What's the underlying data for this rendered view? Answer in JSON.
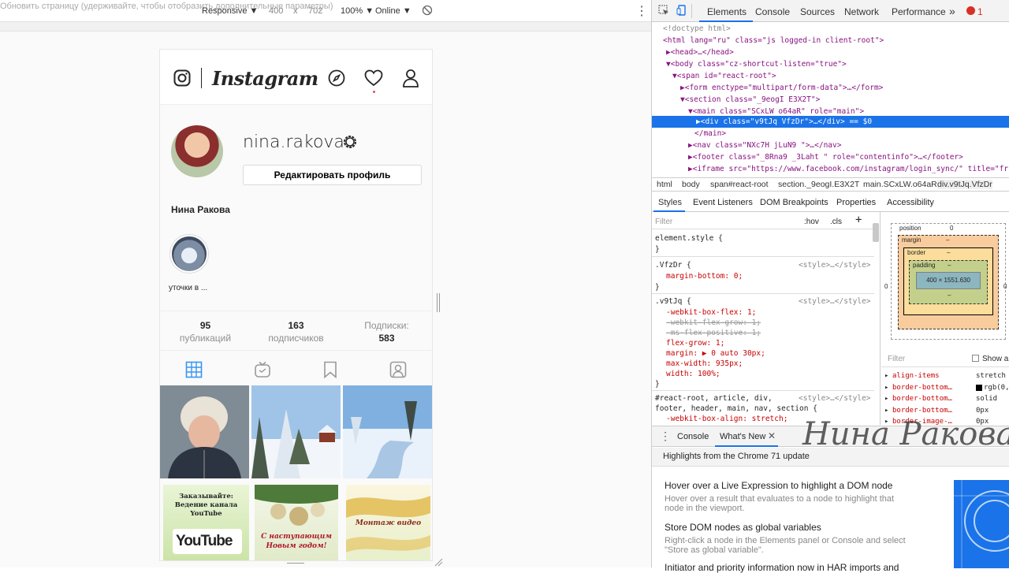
{
  "devbar": {
    "tooltip": "Обновить страницу (удерживайте, чтобы отобразить дополнительные параметры)",
    "device": "Responsive ▼",
    "width": "400",
    "x": "x",
    "height": "702",
    "zoom": "100% ▼",
    "network": "Online ▼"
  },
  "ig": {
    "logo": "Instagram",
    "username": "nina.rakova",
    "edit_profile": "Редактировать профиль",
    "full_name": "Нина Ракова",
    "highlight_label": "уточки в ...",
    "stats": [
      {
        "n": "95",
        "l": "публикаций"
      },
      {
        "n": "163",
        "l": "подписчиков"
      },
      {
        "n": "583",
        "l": "Подписки:"
      }
    ],
    "tiles": {
      "t4_line1": "Заказывайте:",
      "t4_line2": "Ведение канала",
      "t4_line3": "YouTube",
      "t4_logo": "YouTube",
      "t5_line1": "С наступающим",
      "t5_line2": "Новым годом!",
      "t6_line1": "Монтаж видео"
    }
  },
  "devtools": {
    "tabs": [
      "Elements",
      "Console",
      "Sources",
      "Network",
      "Performance",
      "»"
    ],
    "error_count": "1",
    "dom": [
      "<!doctype html>",
      "<html lang=\"ru\" class=\"js logged-in client-root\">",
      "▶<head>…</head>",
      "▼<body class=\"cz-shortcut-listen=\"true\">",
      "▼<span id=\"react-root\">",
      "▶<form enctype=\"multipart/form-data\">…</form>",
      "▼<section class=\"_9eogI E3X2T\">",
      "▼<main class=\"SCxLW  o64aR\" role=\"main\">",
      "▶<div class=\"v9tJq VfzDr\">…</div> == $0",
      "</main>",
      "▶<nav class=\"NXc7H jLuN9  \">…</nav>",
      "▶<footer class=\"_8Rna9  _3Laht \" role=\"contentinfo\">…</footer>",
      "▶<iframe src=\"https://www.facebook.com/instagram/login_sync/\" title=\"fr"
    ],
    "crumbs": [
      "html",
      "body",
      "span#react-root",
      "section._9eogI.E3X2T",
      "main.SCxLW.o64aR",
      "div.v9tJq.VfzDr"
    ],
    "subtabs": [
      "Styles",
      "Event Listeners",
      "DOM Breakpoints",
      "Properties",
      "Accessibility"
    ],
    "filter_placeholder": "Filter",
    "hov": ":hov",
    "cls": ".cls",
    "styles": [
      {
        "t": "element.style {",
        "c": "sel"
      },
      {
        "t": "}",
        "c": "sel"
      },
      {
        "t": ".VfzDr {",
        "c": "sel",
        "src": "<style>…</style>"
      },
      {
        "t": "margin-bottom: 0;",
        "c": "p"
      },
      {
        "t": "}",
        "c": "sel"
      },
      {
        "t": ".v9tJq {",
        "c": "sel",
        "src": "<style>…</style>"
      },
      {
        "t": "-webkit-box-flex: 1;",
        "c": "p"
      },
      {
        "t": "-webkit-flex-grow: 1;",
        "c": "s"
      },
      {
        "t": "-ms-flex-positive: 1;",
        "c": "s"
      },
      {
        "t": "flex-grow: 1;",
        "c": "p"
      },
      {
        "t": "margin: ▶ 0 auto 30px;",
        "c": "p"
      },
      {
        "t": "max-width: 935px;",
        "c": "p"
      },
      {
        "t": "width: 100%;",
        "c": "p"
      },
      {
        "t": "}",
        "c": "sel"
      },
      {
        "t": "#react-root, article, div,",
        "c": "sel",
        "src": "<style>…</style>"
      },
      {
        "t": "footer, header, main, nav, section {",
        "c": "sel"
      },
      {
        "t": "-webkit-box-align: stretch;",
        "c": "p"
      }
    ],
    "boxmodel": {
      "position": "position",
      "position_val": "0",
      "margin": "margin",
      "border": "border",
      "padding": "padding",
      "dash": "–",
      "content": "400 × 1551.630",
      "side_left": "0",
      "side_right": "0"
    },
    "computed_filter": "Filter",
    "show_all": "Show a",
    "computed": [
      {
        "k": "align-items",
        "v": "stretch"
      },
      {
        "k": "border-bottom…",
        "v": "rgb(0,"
      },
      {
        "k": "border-bottom…",
        "v": "solid"
      },
      {
        "k": "border-bottom…",
        "v": "0px"
      },
      {
        "k": "border-image-…",
        "v": "0px"
      }
    ],
    "drawer_tabs": [
      "Console",
      "What's New"
    ],
    "whats_new_header": "Highlights from the Chrome 71 update",
    "whats_new": [
      {
        "title": "Hover over a Live Expression to highlight a DOM node",
        "sub1": "Hover over a result that evaluates to a node to highlight that",
        "sub2": "node in the viewport."
      },
      {
        "title": "Store DOM nodes as global variables",
        "sub1": "Right-click a node in the Elements panel or Console and select",
        "sub2": "\"Store as global variable\"."
      },
      {
        "title": "Initiator and priority information now in HAR imports and",
        "sub1": "",
        "sub2": ""
      }
    ]
  },
  "signature": "Нина Ракова"
}
